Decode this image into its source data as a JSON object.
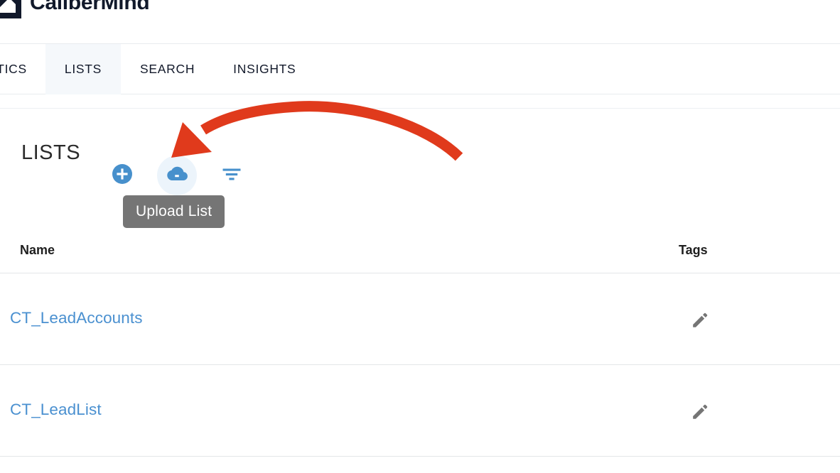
{
  "brand": {
    "name": "CaliberMind",
    "logo_icon": "calibermind-logo-icon",
    "logo_color": "#11192b"
  },
  "tabs": [
    {
      "label": "NALYTICS",
      "active": false,
      "clipped": true
    },
    {
      "label": "LISTS",
      "active": true,
      "clipped": false
    },
    {
      "label": "SEARCH",
      "active": false,
      "clipped": false
    },
    {
      "label": "INSIGHTS",
      "active": false,
      "clipped": false
    }
  ],
  "toolbar": {
    "title": "LISTS",
    "add_icon": "plus-circle-icon",
    "add_label": "Add List",
    "upload_icon": "cloud-upload-icon",
    "upload_label": "Upload List",
    "filter_icon": "filter-icon",
    "filter_label": "Filter"
  },
  "tooltip": {
    "text": "Upload List",
    "background": "#757575"
  },
  "table": {
    "columns": [
      "Name",
      "Tags"
    ],
    "rows": [
      {
        "name": "CT_LeadAccounts",
        "tags_icon": "pencil-edit-icon"
      },
      {
        "name": "CT_LeadList",
        "tags_icon": "pencil-edit-icon"
      }
    ]
  },
  "annotation": {
    "type": "curved-arrow",
    "color": "#e03a1c",
    "points_to": "upload-list-button"
  },
  "colors": {
    "accent_blue": "#4a90d0",
    "icon_blue": "#3f8ed0",
    "link_blue": "#4a90d0",
    "hover_bg": "#ecf4fb",
    "annotation_red": "#e03a1c",
    "tab_active_bg": "#f5f8fb",
    "divider": "#e4e6e8"
  }
}
